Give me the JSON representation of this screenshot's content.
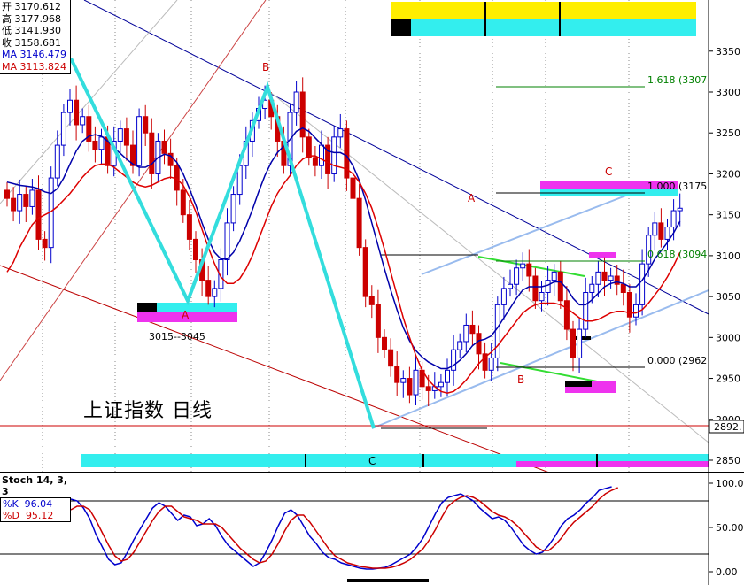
{
  "info": {
    "open_label": "开",
    "open": "3170.612",
    "high_label": "高",
    "high": "3177.968",
    "low_label": "低",
    "low": "3141.930",
    "close_label": "收",
    "close": "3158.681",
    "ma1_label": "MA",
    "ma1": "3146.479",
    "ma2_label": "MA",
    "ma2": "3113.824"
  },
  "chart_title": "上证指数 日线",
  "stoch": {
    "title": "Stoch 14, 3, 3",
    "k_label": "%K",
    "k": "96.04",
    "d_label": "%D",
    "d": "95.12"
  },
  "chart_data": {
    "type": "candlestick",
    "price_axis": {
      "ticks": [
        "3350",
        "3300",
        "3250",
        "3200",
        "3150",
        "3100",
        "3050",
        "3000",
        "2950",
        "2900",
        "2850"
      ],
      "ylim": [
        2840,
        3400
      ],
      "current_marker": "2892."
    },
    "stoch_axis": {
      "ticks": [
        "100.00",
        "50.00",
        "0.00"
      ],
      "ylim": [
        -5,
        105
      ]
    },
    "fib_levels": [
      {
        "label": "1.618 (3307",
        "value": 3307,
        "color": "#008000"
      },
      {
        "label": "1.000 (3175",
        "value": 3175,
        "color": "#000000"
      },
      {
        "label": "0.618 (3094",
        "value": 3094,
        "color": "#008000"
      },
      {
        "label": "0.000 (2962",
        "value": 2962,
        "color": "#000000"
      }
    ],
    "wave_labels": [
      {
        "text": "A",
        "color": "#cc0000"
      },
      {
        "text": "B",
        "color": "#cc0000"
      },
      {
        "text": "C",
        "color": "#000000"
      },
      {
        "text": "A",
        "color": "#cc0000"
      },
      {
        "text": "B",
        "color": "#cc0000"
      },
      {
        "text": "C",
        "color": "#cc0000"
      }
    ],
    "range_note": "3015--3045",
    "price_series_colors": {
      "up": "#0000cc",
      "down": "#cc0000",
      "ma_fast": "#0000aa",
      "ma_slow": "#dd0000"
    },
    "close": [
      3170,
      3155,
      3175,
      3160,
      3180,
      3120,
      3110,
      3195,
      3235,
      3275,
      3290,
      3260,
      3270,
      3240,
      3230,
      3245,
      3210,
      3240,
      3255,
      3235,
      3210,
      3270,
      3250,
      3200,
      3240,
      3225,
      3210,
      3180,
      3150,
      3120,
      3095,
      3070,
      3050,
      3060,
      3095,
      3140,
      3175,
      3210,
      3240,
      3265,
      3280,
      3290,
      3270,
      3240,
      3210,
      3275,
      3300,
      3245,
      3220,
      3210,
      3235,
      3200,
      3245,
      3255,
      3195,
      3170,
      3110,
      3050,
      3040,
      3000,
      2985,
      2965,
      2945,
      2950,
      2930,
      2960,
      2940,
      2935,
      2940,
      2945,
      2960,
      2985,
      2995,
      3015,
      3005,
      2980,
      2960,
      2975,
      3040,
      3060,
      3065,
      3085,
      3090,
      3075,
      3045,
      3055,
      3070,
      3080,
      3045,
      3010,
      2975,
      3010,
      3055,
      3065,
      3080,
      3070,
      3075,
      3065,
      3055,
      3025,
      3040,
      3090,
      3125,
      3140,
      3120,
      3135,
      3155,
      3158
    ],
    "ma_fast": [
      3190,
      3188,
      3186,
      3185,
      3184,
      3182,
      3178,
      3176,
      3182,
      3195,
      3212,
      3228,
      3240,
      3246,
      3248,
      3246,
      3240,
      3232,
      3225,
      3218,
      3212,
      3208,
      3208,
      3212,
      3220,
      3224,
      3222,
      3214,
      3200,
      3182,
      3162,
      3140,
      3120,
      3104,
      3096,
      3096,
      3104,
      3118,
      3136,
      3156,
      3178,
      3198,
      3214,
      3226,
      3234,
      3242,
      3252,
      3256,
      3252,
      3244,
      3236,
      3228,
      3226,
      3226,
      3222,
      3210,
      3192,
      3168,
      3140,
      3112,
      3084,
      3058,
      3034,
      3012,
      2996,
      2984,
      2976,
      2970,
      2966,
      2962,
      2962,
      2966,
      2972,
      2980,
      2990,
      2996,
      2998,
      3002,
      3012,
      3024,
      3036,
      3048,
      3058,
      3062,
      3062,
      3062,
      3064,
      3068,
      3068,
      3060,
      3048,
      3040,
      3040,
      3046,
      3054,
      3062,
      3066,
      3068,
      3066,
      3062,
      3062,
      3070,
      3082,
      3096,
      3106,
      3116,
      3128,
      3142
    ],
    "ma_slow": [
      3080,
      3092,
      3110,
      3124,
      3138,
      3146,
      3150,
      3154,
      3160,
      3168,
      3176,
      3186,
      3196,
      3204,
      3210,
      3212,
      3212,
      3208,
      3202,
      3196,
      3190,
      3186,
      3184,
      3186,
      3190,
      3194,
      3196,
      3194,
      3186,
      3172,
      3154,
      3132,
      3110,
      3090,
      3074,
      3066,
      3066,
      3072,
      3084,
      3100,
      3120,
      3140,
      3160,
      3176,
      3188,
      3198,
      3210,
      3218,
      3222,
      3222,
      3218,
      3214,
      3210,
      3208,
      3206,
      3200,
      3190,
      3176,
      3158,
      3134,
      3108,
      3080,
      3052,
      3024,
      3000,
      2978,
      2960,
      2948,
      2940,
      2934,
      2932,
      2934,
      2940,
      2948,
      2958,
      2968,
      2976,
      2982,
      2990,
      3000,
      3010,
      3020,
      3030,
      3036,
      3040,
      3042,
      3042,
      3042,
      3040,
      3036,
      3030,
      3024,
      3020,
      3020,
      3022,
      3026,
      3030,
      3032,
      3032,
      3030,
      3030,
      3034,
      3042,
      3052,
      3062,
      3074,
      3088,
      3104
    ],
    "stoch_k": [
      82,
      80,
      72,
      60,
      42,
      28,
      14,
      8,
      10,
      22,
      36,
      48,
      60,
      72,
      78,
      74,
      66,
      58,
      64,
      62,
      52,
      54,
      60,
      52,
      40,
      30,
      24,
      18,
      12,
      6,
      10,
      22,
      36,
      52,
      66,
      70,
      64,
      52,
      40,
      32,
      22,
      16,
      14,
      10,
      8,
      6,
      4,
      3,
      3,
      4,
      5,
      8,
      12,
      16,
      20,
      28,
      38,
      52,
      66,
      78,
      84,
      86,
      88,
      84,
      80,
      72,
      66,
      60,
      62,
      58,
      50,
      40,
      30,
      24,
      20,
      22,
      30,
      40,
      52,
      60,
      64,
      70,
      78,
      84,
      92,
      94,
      96
    ],
    "stoch_d": [
      70,
      74,
      74,
      70,
      58,
      44,
      30,
      18,
      12,
      14,
      22,
      34,
      46,
      58,
      68,
      74,
      74,
      68,
      62,
      60,
      58,
      54,
      54,
      54,
      50,
      42,
      34,
      26,
      20,
      14,
      10,
      12,
      20,
      32,
      46,
      58,
      64,
      64,
      56,
      46,
      36,
      26,
      18,
      14,
      10,
      8,
      6,
      5,
      4,
      4,
      4,
      5,
      7,
      10,
      14,
      20,
      26,
      36,
      48,
      62,
      74,
      80,
      84,
      86,
      84,
      80,
      74,
      68,
      64,
      62,
      58,
      52,
      44,
      36,
      28,
      24,
      24,
      30,
      38,
      48,
      56,
      62,
      68,
      74,
      82,
      88,
      92,
      95
    ]
  }
}
